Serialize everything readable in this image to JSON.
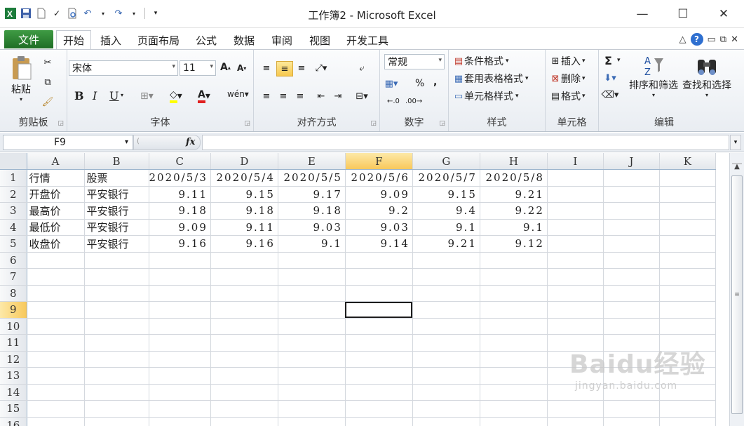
{
  "window": {
    "title": "工作簿2 - Microsoft Excel",
    "minimize": "—",
    "maximize": "☐",
    "close": "✕"
  },
  "tabs": {
    "file": "文件",
    "items": [
      "开始",
      "插入",
      "页面布局",
      "公式",
      "数据",
      "审阅",
      "视图",
      "开发工具"
    ],
    "active": "开始"
  },
  "ribbon": {
    "clipboard": {
      "paste": "粘贴",
      "label": "剪贴板"
    },
    "font": {
      "name": "宋体",
      "size": "11",
      "bold": "B",
      "italic": "I",
      "underline": "U",
      "label": "字体"
    },
    "alignment": {
      "label": "对齐方式"
    },
    "number": {
      "format": "常规",
      "percent": "%",
      "comma": ",",
      "label": "数字"
    },
    "styles": {
      "conditional": "条件格式",
      "table": "套用表格格式",
      "cell": "单元格样式",
      "label": "样式"
    },
    "cells": {
      "insert": "插入",
      "delete": "删除",
      "format": "格式",
      "label": "单元格"
    },
    "editing": {
      "sum": "Σ",
      "sort": "排序和筛选",
      "find": "查找和选择",
      "label": "编辑"
    }
  },
  "formula_bar": {
    "name_box": "F9",
    "fx": "fx",
    "value": ""
  },
  "sheet": {
    "columns": [
      "A",
      "B",
      "C",
      "D",
      "E",
      "F",
      "G",
      "H",
      "I",
      "J",
      "K"
    ],
    "selected_column": "F",
    "selected_row": 9,
    "rows": [
      [
        "行情",
        "股票",
        "2020/5/3",
        "2020/5/4",
        "2020/5/5",
        "2020/5/6",
        "2020/5/7",
        "2020/5/8",
        "",
        "",
        ""
      ],
      [
        "开盘价",
        "平安银行",
        "9.11",
        "9.15",
        "9.17",
        "9.09",
        "9.15",
        "9.21",
        "",
        "",
        ""
      ],
      [
        "最高价",
        "平安银行",
        "9.18",
        "9.18",
        "9.18",
        "9.2",
        "9.4",
        "9.22",
        "",
        "",
        ""
      ],
      [
        "最低价",
        "平安银行",
        "9.09",
        "9.11",
        "9.03",
        "9.03",
        "9.1",
        "9.1",
        "",
        "",
        ""
      ],
      [
        "收盘价",
        "平安银行",
        "9.16",
        "9.16",
        "9.1",
        "9.14",
        "9.21",
        "9.12",
        "",
        "",
        ""
      ],
      [
        "",
        "",
        "",
        "",
        "",
        "",
        "",
        "",
        "",
        "",
        ""
      ],
      [
        "",
        "",
        "",
        "",
        "",
        "",
        "",
        "",
        "",
        "",
        ""
      ],
      [
        "",
        "",
        "",
        "",
        "",
        "",
        "",
        "",
        "",
        "",
        ""
      ],
      [
        "",
        "",
        "",
        "",
        "",
        "",
        "",
        "",
        "",
        "",
        ""
      ],
      [
        "",
        "",
        "",
        "",
        "",
        "",
        "",
        "",
        "",
        "",
        ""
      ],
      [
        "",
        "",
        "",
        "",
        "",
        "",
        "",
        "",
        "",
        "",
        ""
      ],
      [
        "",
        "",
        "",
        "",
        "",
        "",
        "",
        "",
        "",
        "",
        ""
      ],
      [
        "",
        "",
        "",
        "",
        "",
        "",
        "",
        "",
        "",
        "",
        ""
      ],
      [
        "",
        "",
        "",
        "",
        "",
        "",
        "",
        "",
        "",
        "",
        ""
      ],
      [
        "",
        "",
        "",
        "",
        "",
        "",
        "",
        "",
        "",
        "",
        ""
      ],
      [
        "",
        "",
        "",
        "",
        "",
        "",
        "",
        "",
        "",
        "",
        ""
      ]
    ]
  },
  "watermark": {
    "brand": "Baidu经验",
    "url": "jingyan.baidu.com"
  },
  "colors": {
    "file_tab": "#2e7d32",
    "selection": "#f8c85b",
    "grid": "#d4d8de"
  }
}
